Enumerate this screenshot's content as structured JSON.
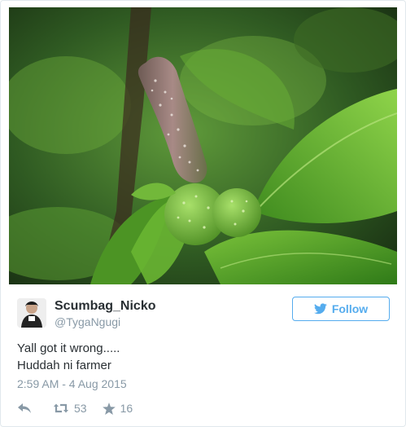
{
  "media": {
    "icon": "photo-icon",
    "colors": {
      "background_dark": "#1f3a16",
      "leaf_green": "#4f9a2b",
      "fruit_green": "#7fc24a",
      "stem_purple": "#8c6a6a"
    }
  },
  "author": {
    "name": "Scumbag_Nicko",
    "handle": "@TygaNgugi",
    "avatar_icon": "avatar-icon"
  },
  "follow_button": {
    "label": "Follow",
    "icon": "bird-icon",
    "color": "#55acee"
  },
  "tweet": {
    "lines": [
      "Yall got it wrong.....",
      "Huddah ni farmer"
    ],
    "timestamp": "2:59 AM - 4 Aug 2015"
  },
  "actions": {
    "reply_icon": "reply-icon",
    "retweet_icon": "retweet-icon",
    "retweet_count": "53",
    "favorite_icon": "star-icon",
    "favorite_count": "16"
  },
  "colors": {
    "text": "#292f33",
    "muted": "#8899a6",
    "accent": "#55acee",
    "border": "#e1e8ed"
  }
}
